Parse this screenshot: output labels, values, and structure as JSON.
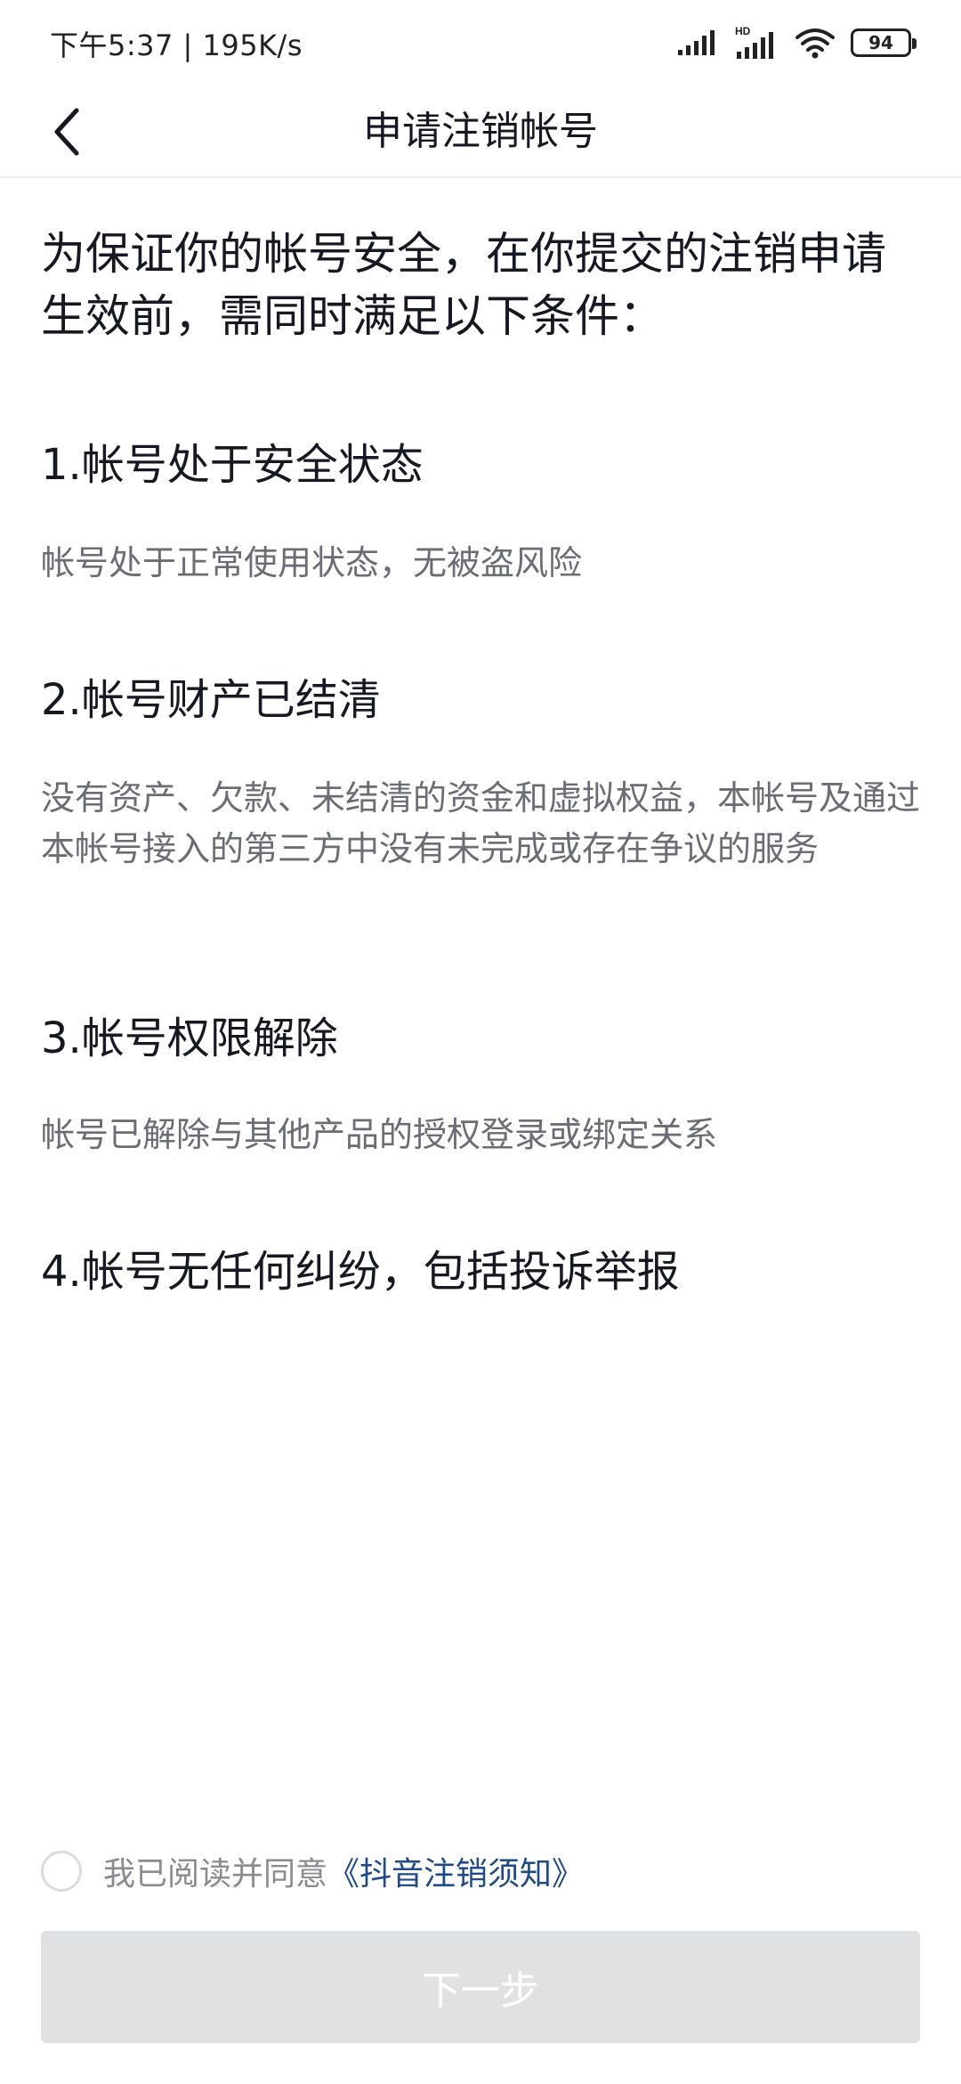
{
  "status_bar": {
    "time_speed": "下午5:37 | 195K/s",
    "network_label": "HD",
    "battery": "94"
  },
  "nav": {
    "title": "申请注销帐号"
  },
  "intro": "为保证你的帐号安全，在你提交的注销申请生效前，需同时满足以下条件：",
  "conditions": [
    {
      "title": "1.帐号处于安全状态",
      "desc": "帐号处于正常使用状态，无被盗风险"
    },
    {
      "title": "2.帐号财产已结清",
      "desc": "没有资产、欠款、未结清的资金和虚拟权益，本帐号及通过本帐号接入的第三方中没有未完成或存在争议的服务"
    },
    {
      "title": "3.帐号权限解除",
      "desc": "帐号已解除与其他产品的授权登录或绑定关系"
    },
    {
      "title": "4.帐号无任何纠纷，包括投诉举报"
    }
  ],
  "agreement": {
    "text": "我已阅读并同意",
    "link": "《抖音注销须知》"
  },
  "next_button": "下一步"
}
